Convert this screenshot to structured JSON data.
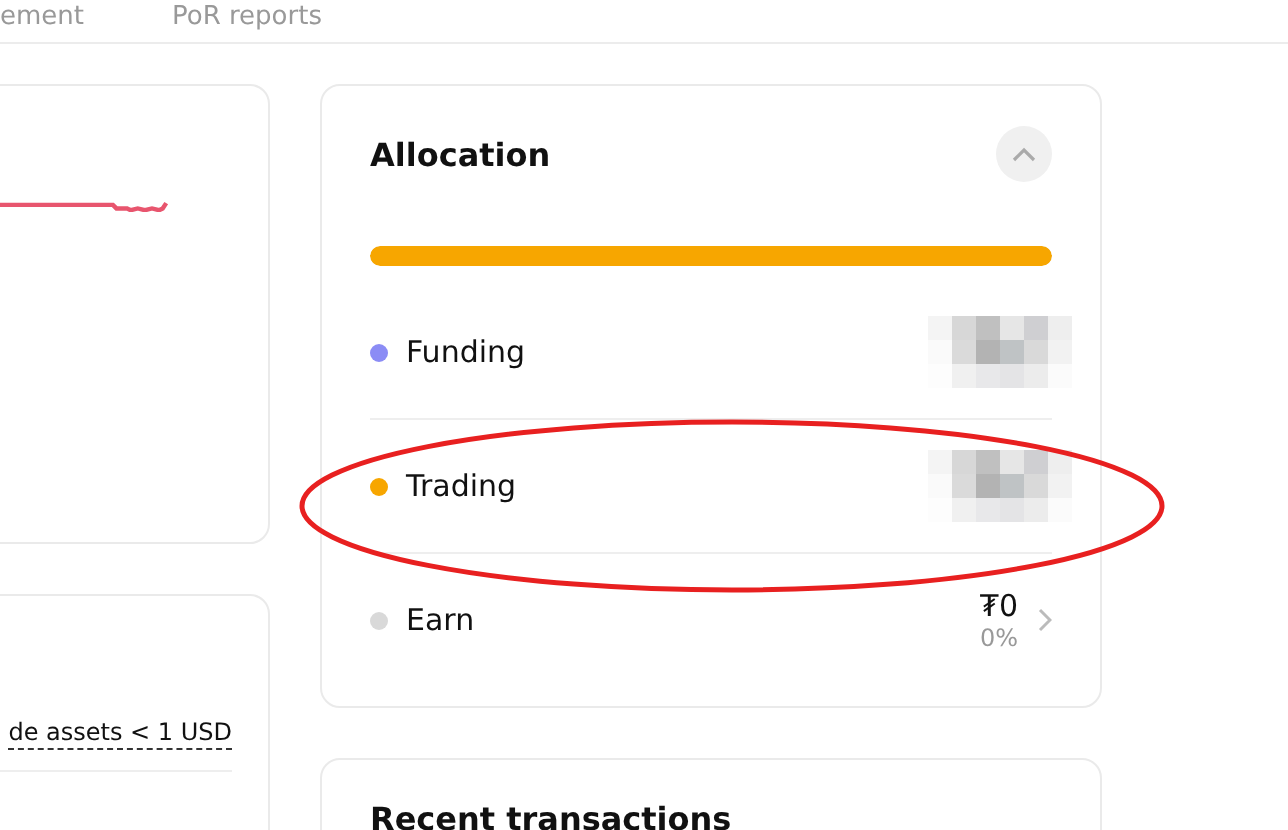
{
  "top_tabs": [
    {
      "label": "ement",
      "selected": false
    },
    {
      "label": "PoR reports",
      "selected": false
    }
  ],
  "assets_card": {
    "filter_link": "de assets < 1 USD"
  },
  "allocation": {
    "title": "Allocation",
    "expanded": true,
    "bar": {
      "level": 1
    },
    "rows": [
      {
        "name": "Funding",
        "color": "#8b8cf5",
        "blurred": true
      },
      {
        "name": "Trading",
        "color": "#f7a600",
        "blurred": true,
        "highlighted": true
      },
      {
        "name": "Earn",
        "color": "#d9d9d9",
        "blurred": false,
        "amount": "₮0",
        "percent": "0%"
      }
    ]
  },
  "recent": {
    "title": "Recent transactions"
  }
}
